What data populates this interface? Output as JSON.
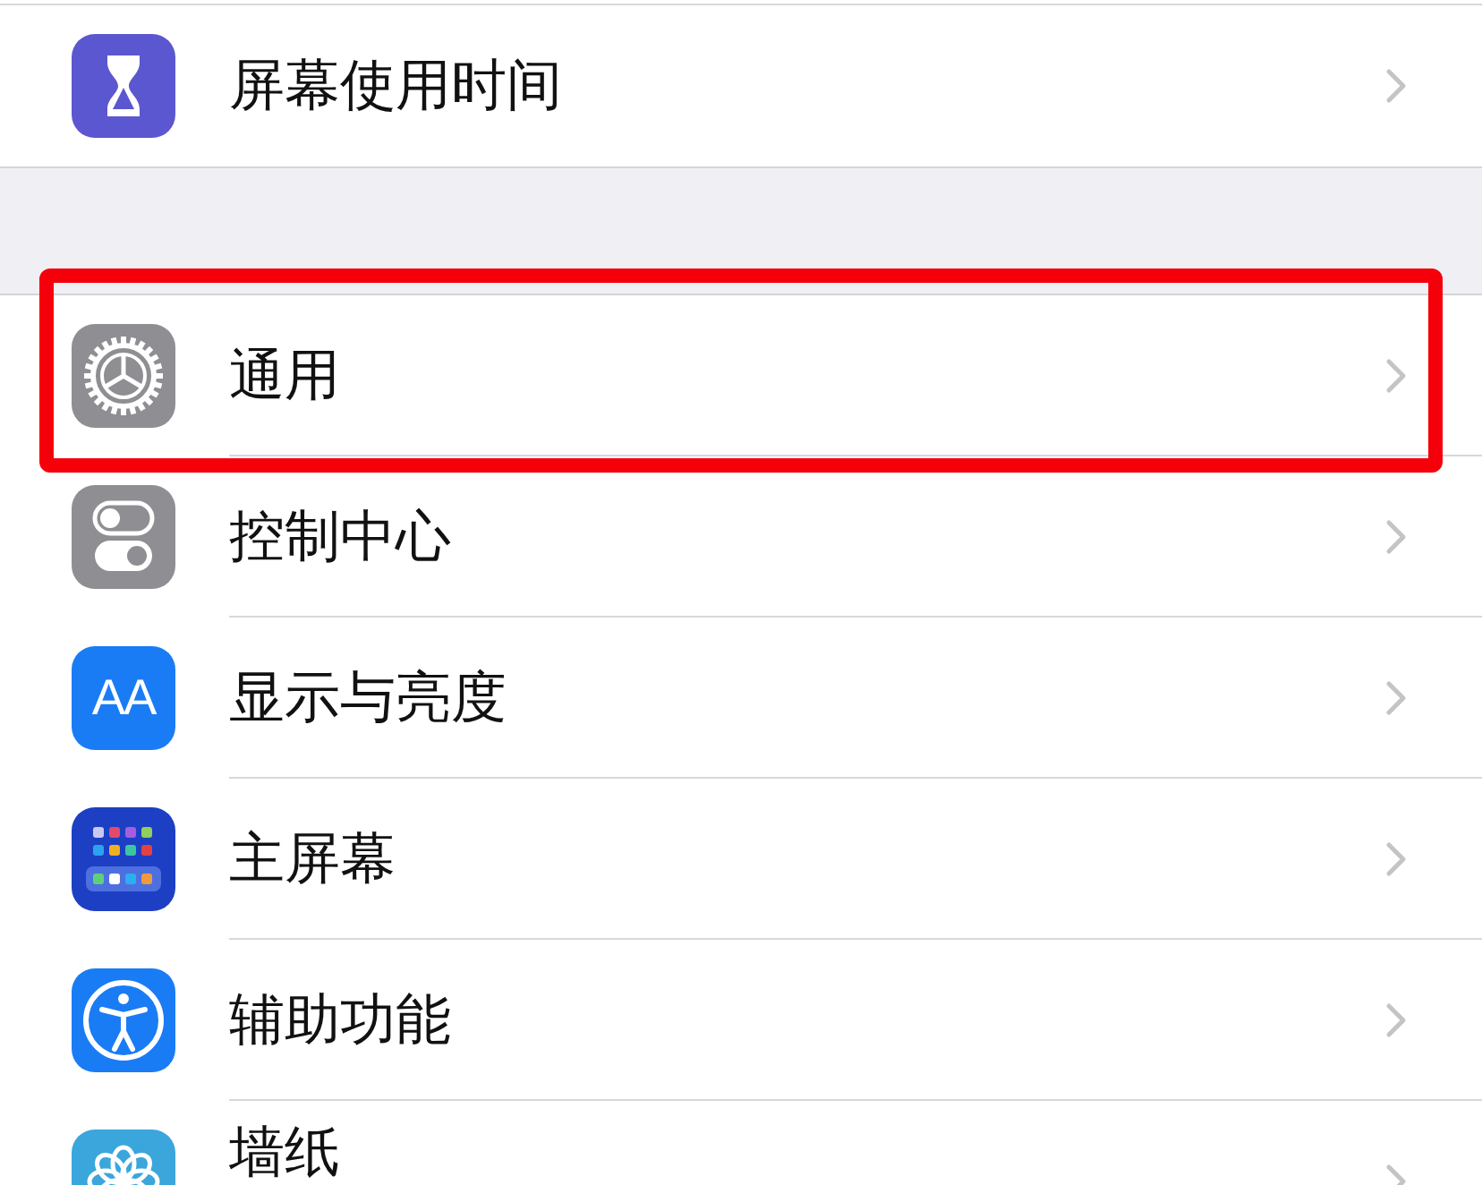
{
  "groups": [
    {
      "items": [
        {
          "kind": "hourglass",
          "color": "#5b57d0",
          "label": "屏幕使用时间",
          "highlighted": false
        }
      ]
    },
    {
      "items": [
        {
          "kind": "gear",
          "color": "#8e8e93",
          "label": "通用",
          "highlighted": true
        },
        {
          "kind": "toggles",
          "color": "#8e8e93",
          "label": "控制中心",
          "highlighted": false
        },
        {
          "kind": "text",
          "color": "#1a7cf5",
          "label": "显示与亮度",
          "icon_text": "AA",
          "highlighted": false
        },
        {
          "kind": "grid",
          "color": "#1c3fc4",
          "label": "主屏幕",
          "highlighted": false
        },
        {
          "kind": "accessibility",
          "color": "#1a7cf5",
          "label": "辅助功能",
          "highlighted": false
        },
        {
          "kind": "flower",
          "color": "#3aa6dc",
          "label": "墙纸",
          "highlighted": false
        }
      ]
    }
  ]
}
